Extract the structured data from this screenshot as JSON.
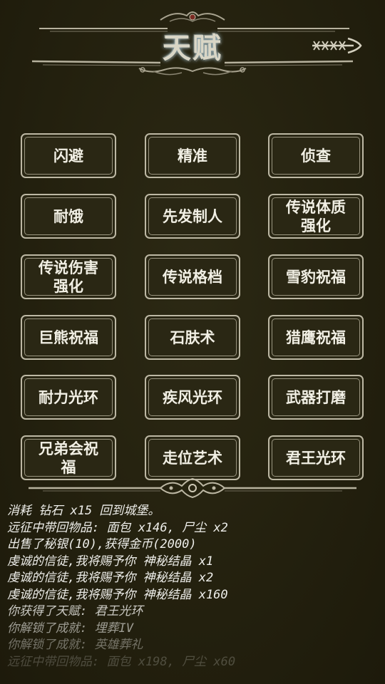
{
  "header": {
    "title": "天赋",
    "back_icon": "arrow-back-icon"
  },
  "talents": [
    [
      "闪避",
      "精准",
      "侦查"
    ],
    [
      "耐饿",
      "先发制人",
      "传说体质强化"
    ],
    [
      "传说伤害强化",
      "传说格档",
      "雪豹祝福"
    ],
    [
      "巨熊祝福",
      "石肤术",
      "猎鹰祝福"
    ],
    [
      "耐力光环",
      "疾风光环",
      "武器打磨"
    ],
    [
      "兄弟会祝福",
      "走位艺术",
      "君王光环"
    ]
  ],
  "log": [
    "消耗 钻石 x15 回到城堡。",
    "远征中带回物品: 面包 x146, 尸尘 x2",
    "出售了秘银(10),获得金币(2000)",
    "虔诚的信徒,我将赐予你 神秘结晶 x1",
    "虔诚的信徒,我将赐予你 神秘结晶 x2",
    "虔诚的信徒,我将赐予你 神秘结晶 x160",
    "你获得了天赋: 君王光环",
    "你解锁了成就: 埋葬IV",
    "你解锁了成就: 英雄葬礼",
    "远征中带回物品: 面包 x198, 尸尘 x60"
  ],
  "colors": {
    "background": "#24210f",
    "button_border": "#bdb8a4",
    "button_text": "#f1efe4",
    "log_text": "#eeeeea"
  }
}
